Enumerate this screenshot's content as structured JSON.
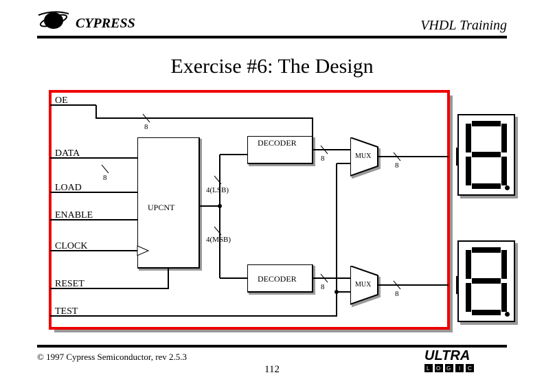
{
  "header": {
    "brand": "CYPRESS",
    "training": "VHDL Training"
  },
  "title": "Exercise #6: The Design",
  "inputs": [
    "OE",
    "DATA",
    "LOAD",
    "ENABLE",
    "CLOCK",
    "RESET",
    "TEST"
  ],
  "blocks": {
    "upcnt": "UPCNT",
    "decoder": "DECODER",
    "mux": "MUX"
  },
  "bus_widths": {
    "oe_loop": "8",
    "data": "8",
    "dec_out": "8",
    "lsb": "4(LSB)",
    "msb": "4(MSB)",
    "mux_out": "8"
  },
  "footer": {
    "copyright": "© 1997 Cypress Semiconductor, rev 2.5.3",
    "page": "112",
    "ultra": "ULTRA",
    "ultra_sub": [
      "L",
      "O",
      "G",
      "I",
      "C"
    ]
  }
}
